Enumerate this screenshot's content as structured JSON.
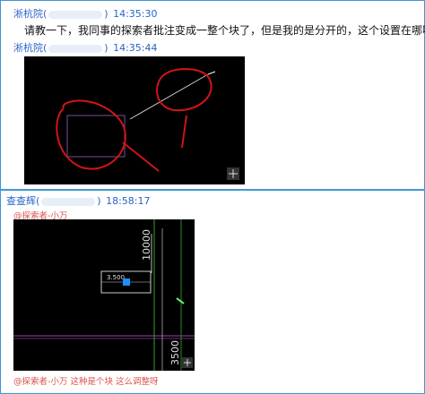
{
  "chat": {
    "messages": [
      {
        "sender": "淅杭院(",
        "sender_tail": ")",
        "time": "14:35:30",
        "text": "请教一下，我同事的探索者批注变成一整个块了，但是我的是分开的，这个设置在哪啊"
      },
      {
        "sender": "淅杭院(",
        "sender_tail": ")",
        "time": "14:35:44",
        "text": ""
      },
      {
        "sender": "查查辉(",
        "sender_tail": ")",
        "time": "18:58:17",
        "mention": "@探索者-小万",
        "caption": "@探索者-小万 这种是个块 这么调整呀",
        "cad_labels": {
          "dim_vertical_top": "10000",
          "dim_vertical_bottom": "3500",
          "annotation": "3.500"
        }
      }
    ]
  },
  "colors": {
    "border": "#3d97d6",
    "sender": "#2a63c7",
    "mention": "#d9534f",
    "annotation_red": "#d01515"
  }
}
